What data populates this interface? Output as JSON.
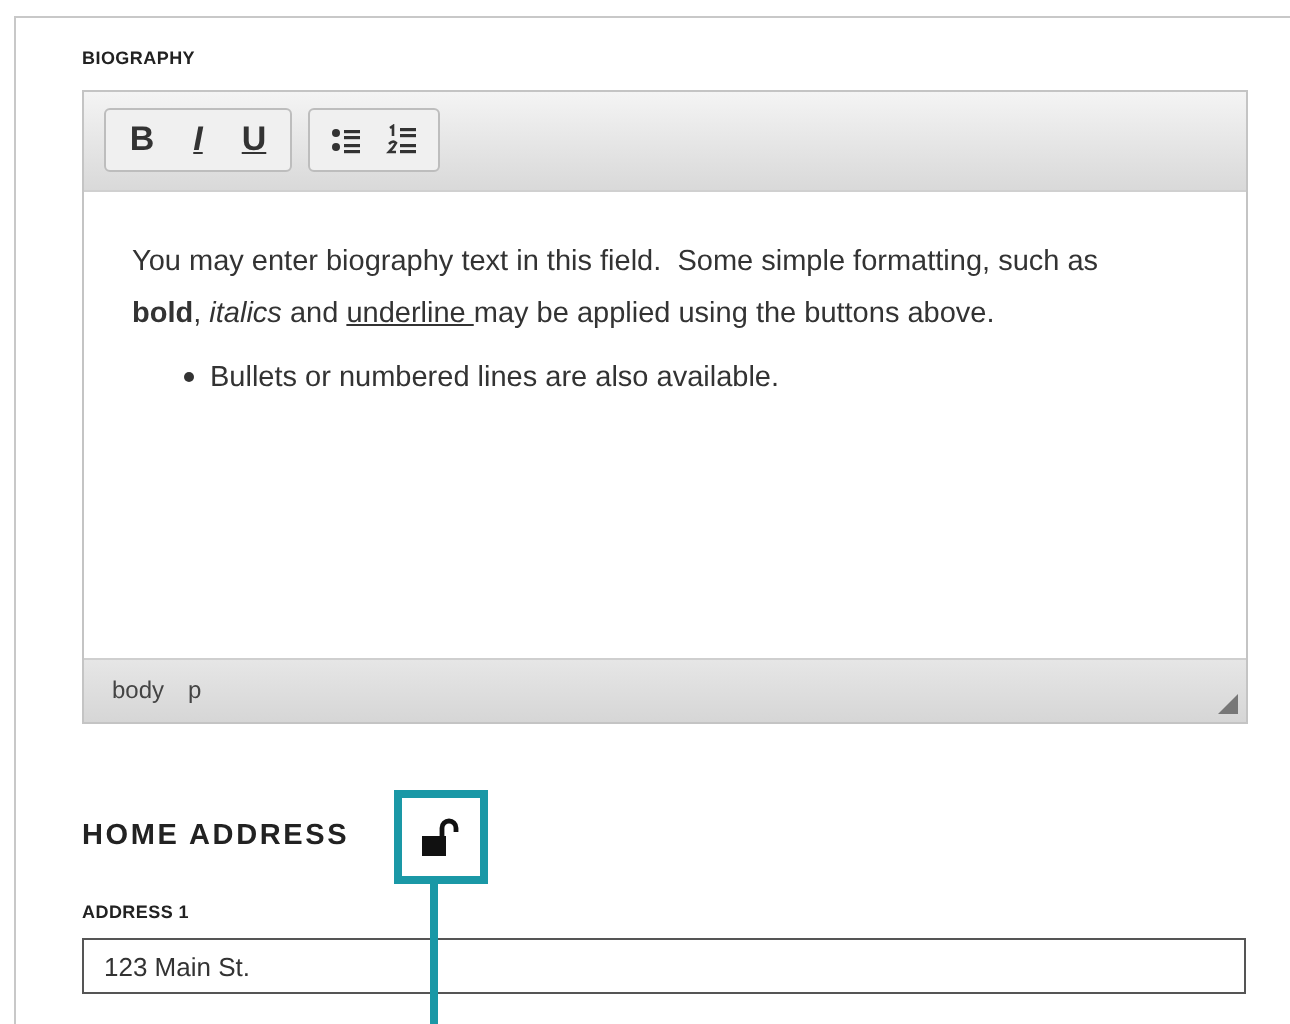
{
  "biography": {
    "label": "BIOGRAPHY",
    "toolbar": [
      {
        "kind": "bold",
        "label": "B"
      },
      {
        "kind": "italic",
        "label": "I"
      },
      {
        "kind": "underline",
        "label": "U"
      },
      {
        "kind": "bullets"
      },
      {
        "kind": "numbers"
      }
    ],
    "paragraph": [
      {
        "kind": "plain",
        "text": "You may enter biography text in this field.  Some simple formatting, such as "
      },
      {
        "kind": "bold",
        "text": "bold"
      },
      {
        "kind": "plain",
        "text": ", "
      },
      {
        "kind": "italic",
        "text": "italics"
      },
      {
        "kind": "plain",
        "text": " and "
      },
      {
        "kind": "underline",
        "text": "underline "
      },
      {
        "kind": "plain",
        "text": "may be applied using the buttons above."
      }
    ],
    "bullets": [
      "Bullets or numbered lines are also available."
    ],
    "path": [
      "body",
      "p"
    ]
  },
  "home_address": {
    "title": "HOME ADDRESS",
    "locked": false,
    "highlighted": true,
    "fields": [
      {
        "label": "ADDRESS 1",
        "value": "123 Main St."
      }
    ]
  }
}
